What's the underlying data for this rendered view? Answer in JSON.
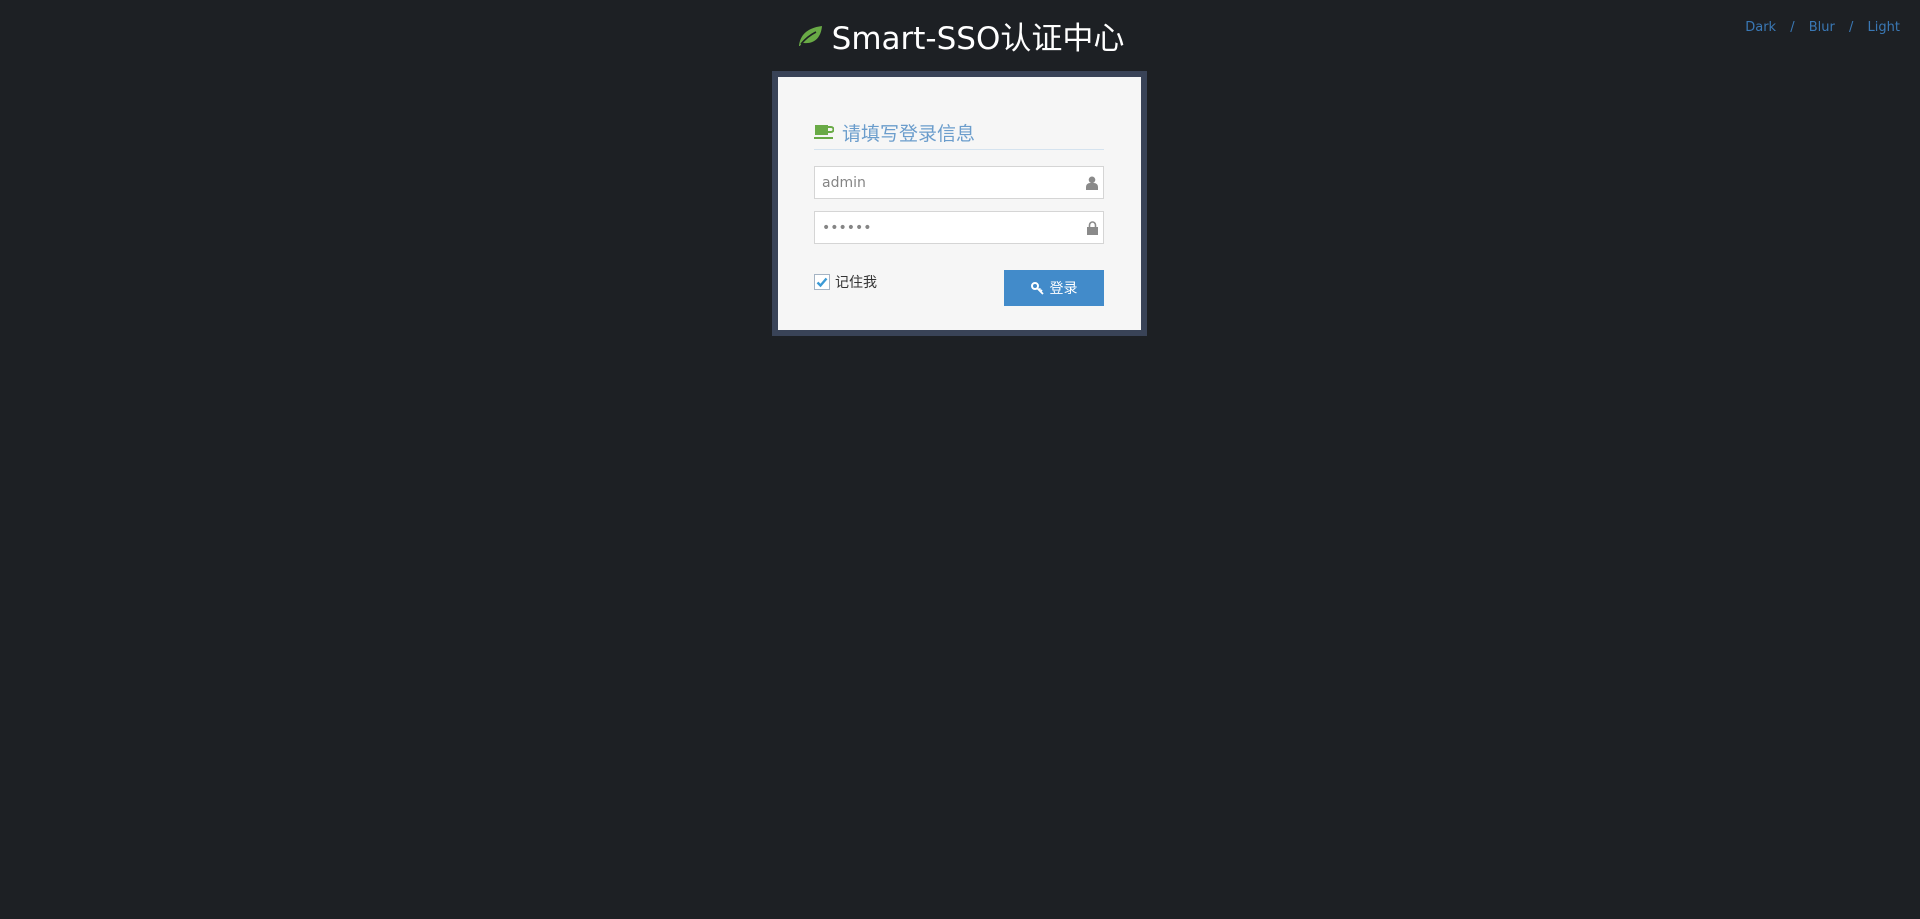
{
  "brand": {
    "title": "Smart-SSO认证中心",
    "icon": "leaf-icon",
    "icon_color": "#69aa46"
  },
  "theme_links": [
    {
      "label": "Dark"
    },
    {
      "label": "Blur"
    },
    {
      "label": "Light"
    }
  ],
  "theme_separator": "/",
  "login_box": {
    "header": "请填写登录信息",
    "header_icon": "coffee-icon",
    "username": {
      "value": "admin",
      "placeholder": "",
      "icon": "user-icon"
    },
    "password": {
      "value": "••••••",
      "placeholder": "",
      "icon": "lock-icon"
    },
    "remember": {
      "label": "记住我",
      "checked": true
    },
    "submit": {
      "label": "登录",
      "icon": "key-icon",
      "color": "#428bca"
    }
  }
}
